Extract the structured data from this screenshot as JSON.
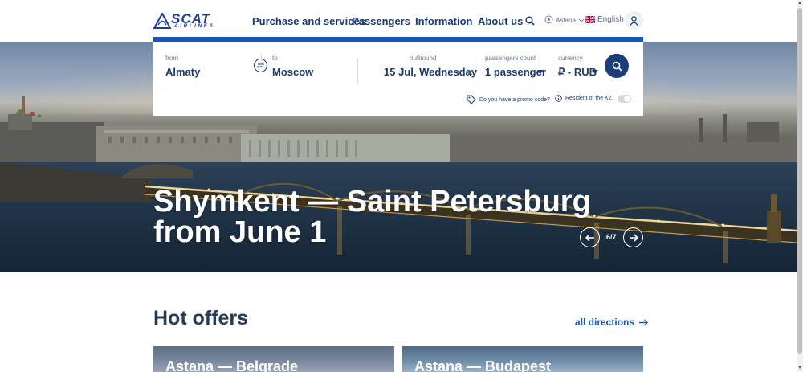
{
  "header": {
    "logo_main": "SCAT",
    "logo_sub": "AIRLINES",
    "nav": [
      "Purchase and services",
      "Passengers",
      "Information",
      "About us"
    ],
    "city": "Astana",
    "language": "English"
  },
  "search": {
    "from_label": "from",
    "from_value": "Almaty",
    "to_label": "to",
    "to_value": "Moscow",
    "outbound_label": "outbound",
    "outbound_value": "15 Jul, Wednesday",
    "passengers_label": "passengers count",
    "passengers_value": "1 passenger",
    "currency_label": "currency",
    "currency_value": "₽ - RUB",
    "promo_text": "Do you have a promo code?",
    "resident_text": "Resident of the KZ",
    "resident_toggle_on": false
  },
  "hero": {
    "title_line1": "Shymkent — Saint Petersburg",
    "title_line2": "from June 1",
    "counter": "6/7"
  },
  "offers": {
    "title": "Hot offers",
    "all_directions": "all directions",
    "cards": [
      {
        "title": "Astana — Belgrade"
      },
      {
        "title": "Astana — Budapest"
      }
    ]
  },
  "colors": {
    "brand_dark": "#1a3b6e",
    "brand_blue": "#1656b8",
    "search_button": "#1b3d7a"
  }
}
